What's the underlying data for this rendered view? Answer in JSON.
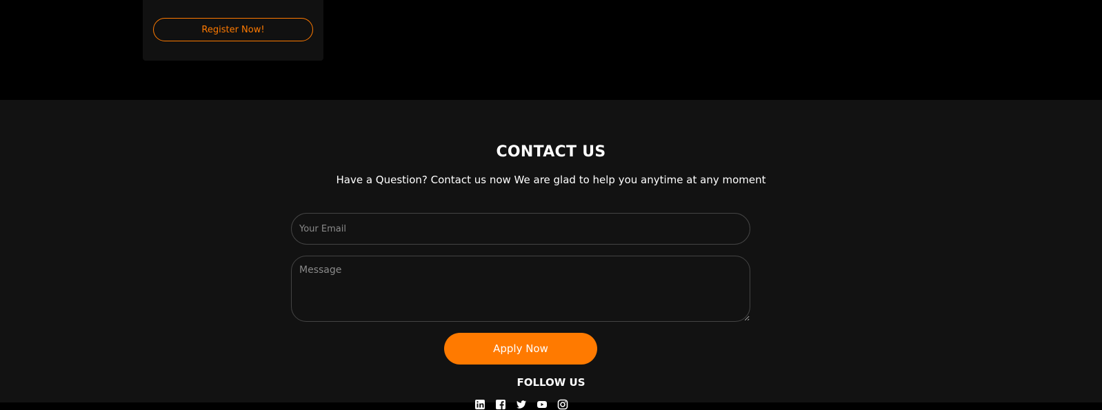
{
  "card": {
    "register_label": "Register Now!"
  },
  "contact": {
    "title": "CONTACT US",
    "subtitle": "Have a Question? Contact us now We are glad to help you anytime at any moment",
    "email_placeholder": "Your Email",
    "email_value": "",
    "message_placeholder": "Message",
    "message_value": "",
    "apply_label": "Apply Now"
  },
  "follow": {
    "title": "FOLLOW US",
    "icons": [
      "linkedin-icon",
      "facebook-icon",
      "twitter-icon",
      "youtube-icon",
      "instagram-icon"
    ]
  },
  "colors": {
    "accent": "#ff7a00",
    "section_bg": "#121212",
    "page_bg": "#000000"
  }
}
